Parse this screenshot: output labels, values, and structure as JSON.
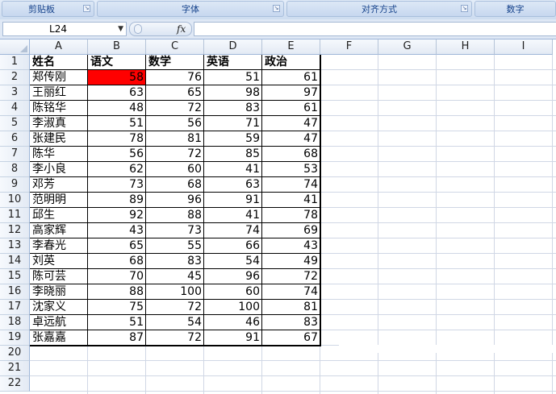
{
  "ribbon": {
    "groups": [
      "剪贴板",
      "字体",
      "对齐方式",
      "数字"
    ]
  },
  "formula_bar": {
    "name_box": "L24",
    "fx_label": "fx",
    "formula": ""
  },
  "columns": [
    "A",
    "B",
    "C",
    "D",
    "E",
    "F",
    "G",
    "H",
    "I"
  ],
  "rows": [
    "1",
    "2",
    "3",
    "4",
    "5",
    "6",
    "7",
    "8",
    "9",
    "10",
    "11",
    "12",
    "13",
    "14",
    "15",
    "16",
    "17",
    "18",
    "19",
    "20",
    "21",
    "22"
  ],
  "table": {
    "headers": [
      "姓名",
      "语文",
      "数学",
      "英语",
      "政治"
    ],
    "records": [
      [
        "郑传刚",
        "58",
        "76",
        "51",
        "61"
      ],
      [
        "王丽红",
        "63",
        "65",
        "98",
        "97"
      ],
      [
        "陈铭华",
        "48",
        "72",
        "83",
        "61"
      ],
      [
        "李淑真",
        "51",
        "56",
        "71",
        "47"
      ],
      [
        "张建民",
        "78",
        "81",
        "59",
        "47"
      ],
      [
        "陈华",
        "56",
        "72",
        "85",
        "68"
      ],
      [
        "李小良",
        "62",
        "60",
        "41",
        "53"
      ],
      [
        "邓芳",
        "73",
        "68",
        "63",
        "74"
      ],
      [
        "范明明",
        "89",
        "96",
        "91",
        "41"
      ],
      [
        "邱生",
        "92",
        "88",
        "41",
        "78"
      ],
      [
        "高家辉",
        "43",
        "73",
        "74",
        "69"
      ],
      [
        "李春光",
        "65",
        "55",
        "66",
        "43"
      ],
      [
        "刘英",
        "68",
        "83",
        "54",
        "49"
      ],
      [
        "陈可芸",
        "70",
        "45",
        "96",
        "72"
      ],
      [
        "李晓丽",
        "88",
        "100",
        "60",
        "74"
      ],
      [
        "沈家义",
        "75",
        "72",
        "100",
        "81"
      ],
      [
        "卓远航",
        "51",
        "54",
        "46",
        "83"
      ],
      [
        "张嘉嘉",
        "87",
        "72",
        "91",
        "67"
      ]
    ]
  },
  "highlight": {
    "cell": "B2",
    "color": "#ff0000"
  }
}
